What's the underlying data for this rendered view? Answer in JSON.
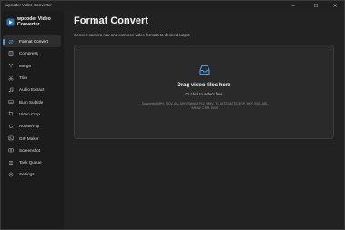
{
  "window": {
    "title": "wpcoder Video Converter",
    "controls": {
      "minimize": "–",
      "maximize": "☐",
      "close": "✕"
    }
  },
  "brand": {
    "name": "wpcoder Video Converter",
    "accent_color": "#4c9be8"
  },
  "sidebar": {
    "items": [
      {
        "label": "Format Convert",
        "icon": "format-convert-icon",
        "active": true
      },
      {
        "label": "Compress",
        "icon": "compress-icon",
        "active": false
      },
      {
        "label": "Merge",
        "icon": "merge-icon",
        "active": false
      },
      {
        "label": "Trim",
        "icon": "trim-icon",
        "active": false
      },
      {
        "label": "Audio Extract",
        "icon": "audio-extract-icon",
        "active": false
      },
      {
        "label": "Burn Subtitle",
        "icon": "burn-subtitle-icon",
        "active": false
      },
      {
        "label": "Video Crop",
        "icon": "video-crop-icon",
        "active": false
      },
      {
        "label": "Rotate/Flip",
        "icon": "rotate-flip-icon",
        "active": false
      },
      {
        "label": "GIF Maker",
        "icon": "gif-maker-icon",
        "active": false
      },
      {
        "label": "Screenshot",
        "icon": "screenshot-icon",
        "active": false
      },
      {
        "label": "Task Queue",
        "icon": "task-queue-icon",
        "active": false
      },
      {
        "label": "Settings",
        "icon": "settings-icon",
        "active": false
      }
    ]
  },
  "main": {
    "title": "Format Convert",
    "subtitle": "Convert camera raw and common video formats to desired output",
    "dropzone": {
      "icon": "upload-tray-icon",
      "title": "Drag video files here",
      "subtitle": "Or click to select files",
      "formats": "Supported: MP4, MOV, AVI, MKV, WebM, FLV, WMV, TS, MTS, M2TS, 3GP, MXF, R3D, ARI, BRAW, CRM, DNG"
    }
  }
}
